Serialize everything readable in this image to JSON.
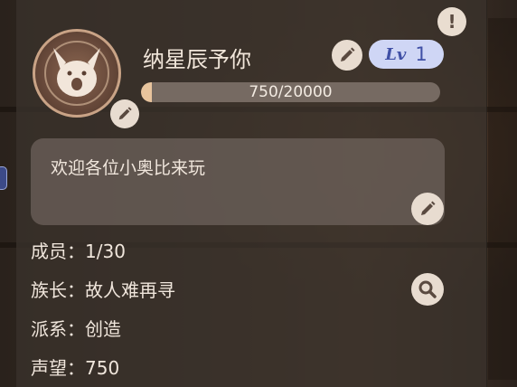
{
  "clan": {
    "name": "纳星辰予你",
    "level_label": "Lv",
    "level": "1",
    "exp_current": 750,
    "exp_max": 20000,
    "exp_text": "750/20000",
    "notice": "欢迎各位小奥比来玩"
  },
  "info": {
    "members_label": "成员：",
    "members_value": "1/30",
    "leader_label": "族长：",
    "leader_value": "故人难再寻",
    "faction_label": "派系：",
    "faction_value": "创造",
    "reputation_label": "声望：",
    "reputation_value": "750"
  },
  "icons": {
    "warning": "exclamation-icon",
    "edit": "pencil-icon",
    "search": "magnifier-icon",
    "avatar": "creature-avatar"
  },
  "colors": {
    "level_badge_bg": "#cfd6f5",
    "level_text": "#4050a6",
    "exp_fill": "#e8c49d",
    "button_bg": "#e8dcd0"
  }
}
